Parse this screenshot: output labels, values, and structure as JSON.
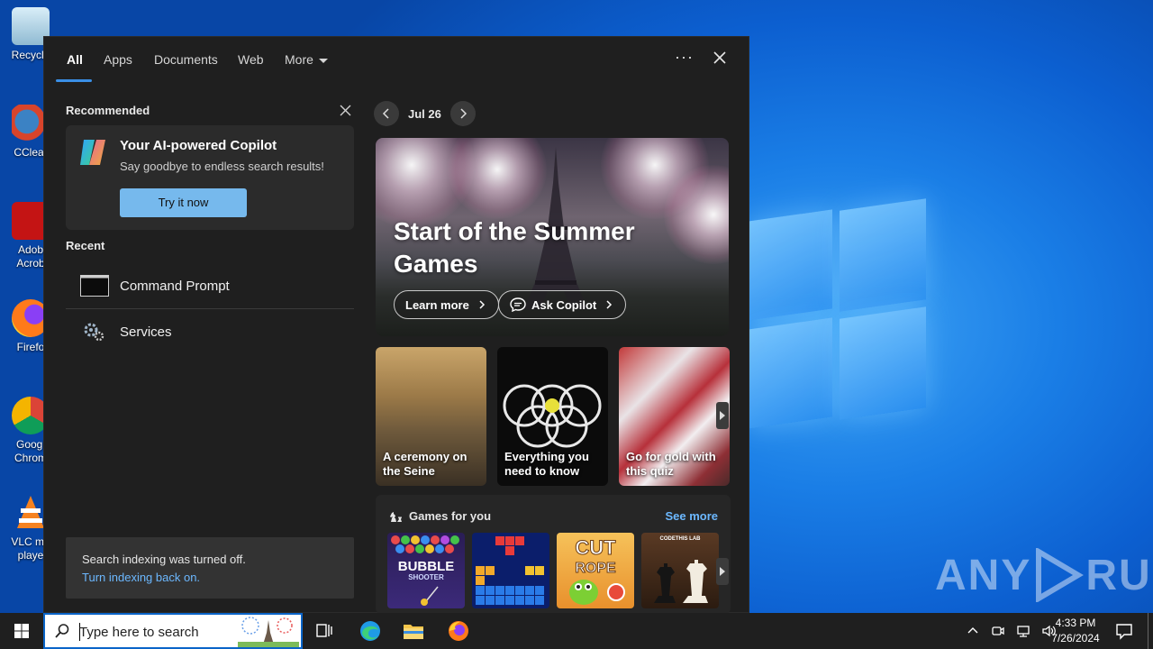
{
  "desktop": {
    "icons": [
      {
        "label": "Recycle"
      },
      {
        "label": "CClear"
      },
      {
        "label": "Adob Acrob"
      },
      {
        "label": "Firefo"
      },
      {
        "label": "Googl Chrom"
      },
      {
        "label": "VLC me playe"
      }
    ],
    "watermark": {
      "left": "ANY",
      "right": "RUN"
    }
  },
  "search_panel": {
    "tabs": [
      {
        "label": "All",
        "active": true
      },
      {
        "label": "Apps"
      },
      {
        "label": "Documents"
      },
      {
        "label": "Web"
      },
      {
        "label": "More"
      }
    ],
    "recommended": {
      "title": "Recommended",
      "card_title": "Your AI-powered Copilot",
      "card_subtitle": "Say goodbye to endless search results!",
      "button_label": "Try it now"
    },
    "recent": {
      "title": "Recent",
      "items": [
        {
          "label": "Command Prompt"
        },
        {
          "label": "Services"
        }
      ]
    },
    "indexing": {
      "message": "Search indexing was turned off.",
      "link": "Turn indexing back on."
    },
    "date_nav": {
      "label": "Jul 26"
    },
    "hero": {
      "title": "Start of the Summer Games",
      "learn_more": "Learn more",
      "ask_copilot": "Ask Copilot"
    },
    "cards": [
      {
        "caption": "A ceremony on the Seine"
      },
      {
        "caption": "Everything you need to know"
      },
      {
        "caption": "Go for gold with this quiz"
      }
    ],
    "games": {
      "title": "Games for you",
      "see_more": "See more",
      "tiles": [
        {
          "title": "BUBBLE SHOOTER"
        },
        {
          "title": "Blocks"
        },
        {
          "title": "CUT the ROPE"
        },
        {
          "title": "CODETHIS LAB"
        }
      ]
    }
  },
  "taskbar": {
    "search_placeholder": "Type here to search",
    "time": "4:33 PM",
    "date": "7/26/2024"
  },
  "colors": {
    "accent": "#3a8fe6",
    "link": "#6cb8ff",
    "panel_bg": "#1f1f1f"
  }
}
